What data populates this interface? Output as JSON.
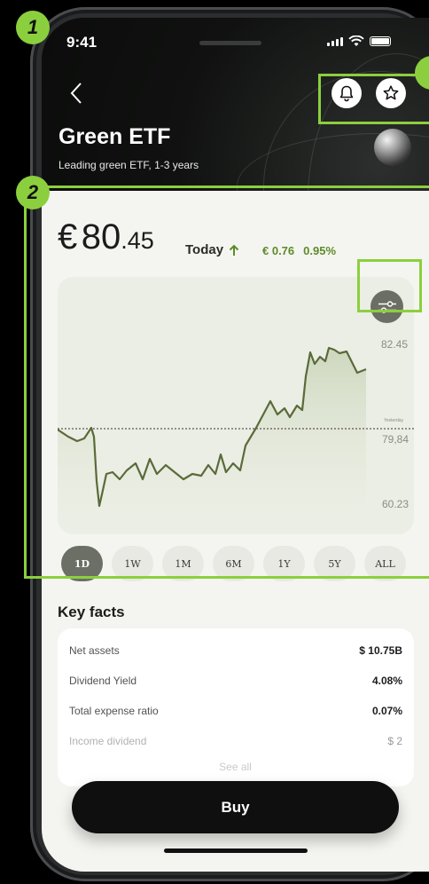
{
  "status": {
    "time": "9:41"
  },
  "header": {
    "title": "Green ETF",
    "subtitle": "Leading green ETF, 1-3 years",
    "icons": [
      "back-icon",
      "bell-icon",
      "star-icon"
    ]
  },
  "price": {
    "currency": "€",
    "whole": "80",
    "decimal": ".45",
    "period_label": "Today",
    "direction_icon": "arrow-up-icon",
    "change_abs": "€ 0.76",
    "change_pct": "0.95%"
  },
  "chart": {
    "y_ticks": [
      "82.45",
      "79,84",
      "60.23"
    ],
    "reference_label": "Yesterday",
    "filter_icon": "sliders-icon",
    "line_color": "#5a6a3a"
  },
  "ranges": [
    "1D",
    "1W",
    "1M",
    "6M",
    "1Y",
    "5Y",
    "ALL"
  ],
  "active_range": "1D",
  "key_facts": {
    "title": "Key facts",
    "rows": [
      {
        "label": "Net assets",
        "value": "$ 10.75B"
      },
      {
        "label": "Dividend Yield",
        "value": "4.08%"
      },
      {
        "label": "Total expense ratio",
        "value": "0.07%"
      },
      {
        "label": "Income dividend",
        "value": "$ 2"
      }
    ],
    "see_all": "See all"
  },
  "actions": {
    "buy_label": "Buy"
  },
  "annotations": {
    "badge_1": "1",
    "badge_2": "2",
    "highlight_color": "#8ccf3e"
  }
}
